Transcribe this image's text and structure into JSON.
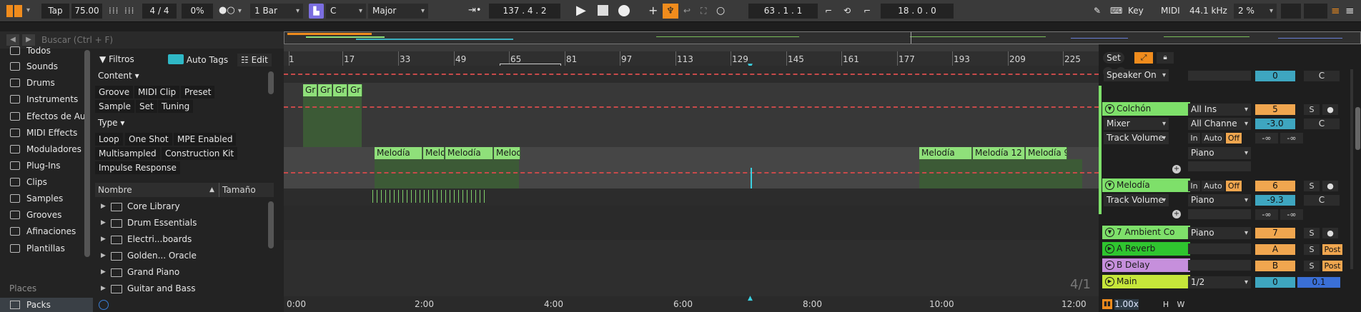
{
  "transport": {
    "tap": "Tap",
    "tempo": "75.00",
    "signature": "4 / 4",
    "swing": "0%",
    "quantize": "1 Bar",
    "key": "C",
    "scale": "Major",
    "position": "137 .  4 .  2",
    "loop_start": "63 .  1 .  1",
    "loop_length": "18 .  0 .  0",
    "key_map": "Key",
    "midi_map": "MIDI",
    "sample_rate": "44.1 kHz",
    "cpu": "2 %"
  },
  "browser": {
    "search_placeholder": "Buscar (Ctrl + F)",
    "categories": [
      "Todos",
      "Sounds",
      "Drums",
      "Instruments",
      "Efectos de Au",
      "MIDI Effects",
      "Moduladores",
      "Plug-Ins",
      "Clips",
      "Samples",
      "Grooves",
      "Afinaciones",
      "Plantillas"
    ],
    "filters_label": "Filtros",
    "auto_tags": "Auto Tags",
    "edit": "Edit",
    "content_label": "Content",
    "content_tags": [
      "Groove",
      "MIDI Clip",
      "Preset",
      "Sample",
      "Set",
      "Tuning"
    ],
    "type_label": "Type",
    "type_tags": [
      "Loop",
      "One Shot",
      "MPE Enabled",
      "Multisampled",
      "Construction Kit",
      "Impulse Response"
    ],
    "col_name": "Nombre",
    "col_size": "Tamaño",
    "items": [
      "Core Library",
      "Drum Essentials",
      "Electri...boards",
      "Golden... Oracle",
      "Grand Piano",
      "Guitar and Bass"
    ],
    "places": "Places",
    "packs": "Packs"
  },
  "arrangement": {
    "ruler": [
      "1",
      "17",
      "33",
      "49",
      "65",
      "81",
      "97",
      "113",
      "129",
      "145",
      "161",
      "177",
      "193",
      "209",
      "225"
    ],
    "times": [
      "0:00",
      "2:00",
      "4:00",
      "6:00",
      "8:00",
      "10:00",
      "12:00"
    ],
    "grain_clips": [
      "Gr",
      "Gr",
      "Gr",
      "Gr"
    ],
    "melodia_clips": [
      "Melodía",
      "Melo",
      "Melodía",
      "Melod",
      "Melodía",
      "Melodía 12",
      "Melodía 9"
    ],
    "zoom_label": "4/1"
  },
  "mixer": {
    "set_label": "Set",
    "speaker_on": "Speaker On",
    "tracks": {
      "colchon": {
        "name": "Colchón",
        "input": "All Ins",
        "channel": "All Channe",
        "number": "5",
        "volume": "-3.0",
        "pan": "C",
        "monitor_in": "In",
        "monitor_auto": "Auto",
        "monitor_off": "Off",
        "inf1": "-∞",
        "inf2": "-∞",
        "output": "Piano",
        "device": "Mixer",
        "param": "Track Volume"
      },
      "melodia": {
        "name": "Melodía",
        "monitor_in": "In",
        "monitor_auto": "Auto",
        "monitor_off": "Off",
        "number": "6",
        "volume": "-9.3",
        "pan": "C",
        "output": "Piano",
        "param": "Track Volume",
        "inf1": "-∞",
        "inf2": "-∞"
      },
      "ambient": {
        "name": "7 Ambient Co",
        "output": "Piano",
        "number": "7"
      },
      "reverb": {
        "name": "A Reverb",
        "letter": "A",
        "post": "Post"
      },
      "delay": {
        "name": "B Delay",
        "letter": "B",
        "post": "Post"
      },
      "main": {
        "name": "Main",
        "output": "1/2",
        "number": "0",
        "volume": "0.1"
      }
    },
    "top_number": "0",
    "top_pan": "C",
    "solo": "S",
    "zoom": "1.00x",
    "h": "H",
    "w": "W"
  },
  "colors": {
    "accent": "#f08c1d",
    "clip_green": "#8fe07a",
    "track_green": "#7ee06a",
    "reverb": "#2fc52f",
    "delay": "#c68fdc",
    "main": "#c6e63a",
    "volume_blue": "#3ea6c0"
  }
}
